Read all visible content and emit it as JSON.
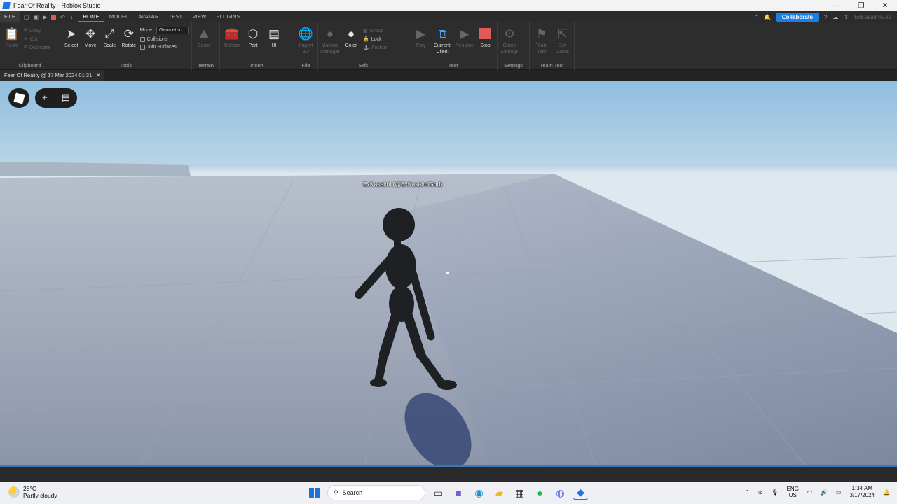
{
  "window": {
    "title": "Fear Of Reality - Roblox Studio",
    "min": "—",
    "max": "❐",
    "close": "✕"
  },
  "menubar": {
    "file": "FILE",
    "tabs": [
      "HOME",
      "MODEL",
      "AVATAR",
      "TEST",
      "VIEW",
      "PLUGINS"
    ],
    "active_tab": "HOME",
    "collaborate": "Collaborate",
    "username": "ExKasaimiGod"
  },
  "ribbon": {
    "clipboard": {
      "label": "Clipboard",
      "paste": "Paste",
      "copy": "Copy",
      "cut": "Cut",
      "duplicate": "Duplicate"
    },
    "tools": {
      "label": "Tools",
      "select": "Select",
      "move": "Move",
      "scale": "Scale",
      "rotate": "Rotate",
      "mode_label": "Mode:",
      "mode_value": "Geometric",
      "collisions": "Collisions",
      "join_surfaces": "Join Surfaces"
    },
    "terrain": {
      "label": "Terrain",
      "editor": "Editor"
    },
    "insert": {
      "label": "Insert",
      "toolbox": "Toolbox",
      "part": "Part",
      "ui": "UI"
    },
    "file": {
      "label": "File",
      "import3d": "Import 3D"
    },
    "edit": {
      "label": "Edit",
      "material": "Material Manager",
      "color": "Color",
      "group": "Group",
      "lock": "Lock",
      "anchor": "Anchor"
    },
    "test": {
      "label": "Test",
      "play": "Play",
      "current": "Current: Client",
      "resume": "Resume",
      "stop": "Stop"
    },
    "settings": {
      "label": "Settings",
      "game_settings": "Game Settings"
    },
    "team_test": {
      "label": "Team Test",
      "team_test": "Team Test",
      "exit_game": "Exit Game"
    }
  },
  "doc_tab": {
    "title": "Fear Of Reality @ 17 Mar 2024 01:31",
    "close": "✕"
  },
  "viewport": {
    "nametag": "ExKasaimi (@ExKasaimiGod)"
  },
  "taskbar": {
    "temp": "28°C",
    "weather": "Partly cloudy",
    "search": "Search",
    "lang1": "ENG",
    "lang2": "US",
    "time": "1:34 AM",
    "date": "3/17/2024"
  },
  "colors": {
    "accent": "#2f8df7",
    "collaborate": "#1a7fe6",
    "stop": "#e05a5a"
  }
}
